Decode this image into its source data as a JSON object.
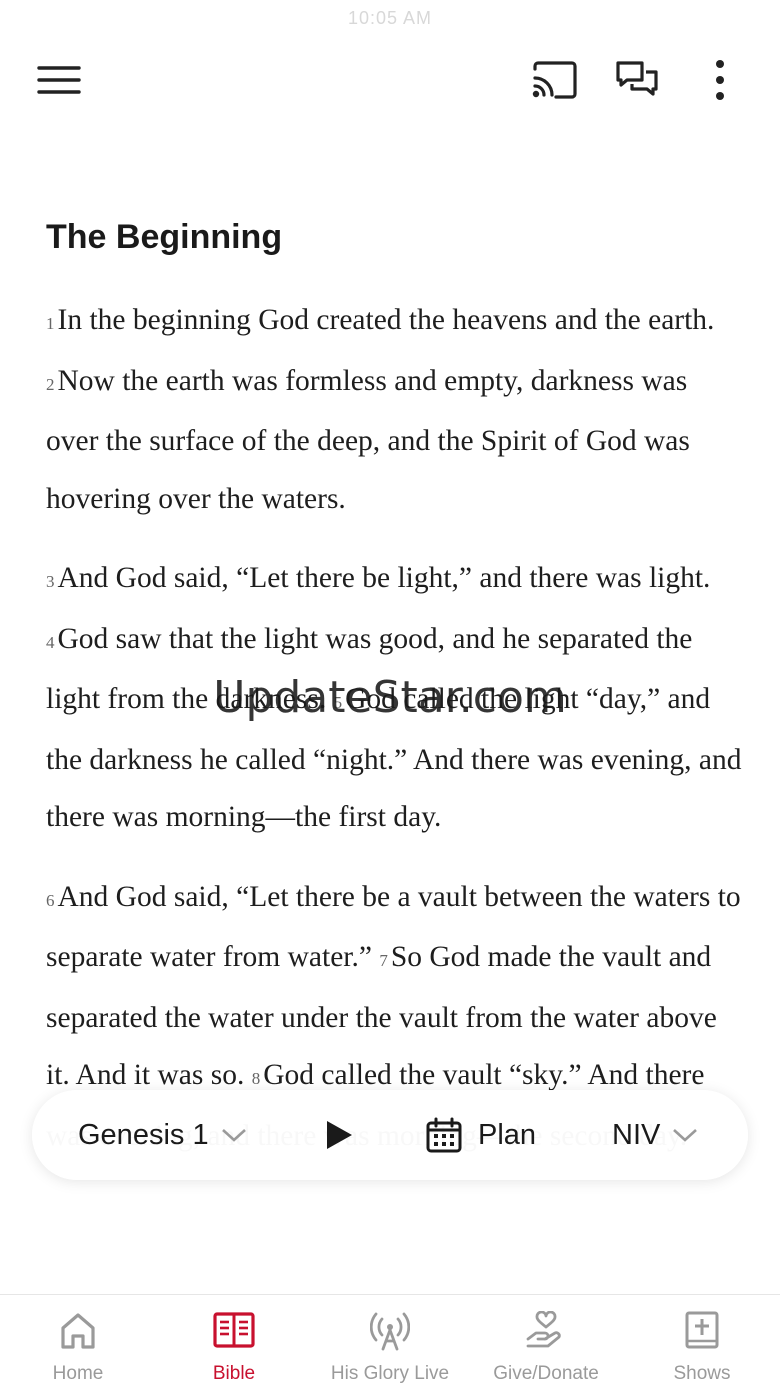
{
  "status": {
    "time": "10:05 AM"
  },
  "topbar": {
    "menu_icon": "hamburger-menu-icon",
    "cast_icon": "cast-icon",
    "chat_icon": "chat-bubbles-icon",
    "more_icon": "more-vertical-icon"
  },
  "passage": {
    "heading": "The Beginning",
    "paragraphs": [
      [
        {
          "n": "1",
          "t": "In the beginning God created the heavens and the earth."
        },
        {
          "n": "2",
          "t": "Now the earth was formless and empty, darkness was over the surface of the deep, and the Spirit of God was hovering over the waters."
        }
      ],
      [
        {
          "n": "3",
          "t": "And God said, “Let there be light,” and there was light."
        },
        {
          "n": "4",
          "t": "God saw that the light was good, and he separated the light from the darkness."
        },
        {
          "n": "5",
          "t": "God called the light “day,” and the darkness he called “night.” And there was evening, and there was morning—the first day."
        }
      ],
      [
        {
          "n": "6",
          "t": "And God said, “Let there be a vault between the waters to separate water from water.”"
        },
        {
          "n": "7",
          "t": "So God made the vault and separated the water under the vault from the water above it. And it was so."
        },
        {
          "n": "8",
          "t": "God called the vault “sky.” And there was evening, and there was morning—the second day."
        }
      ]
    ]
  },
  "watermark": "UpdateStar.com",
  "controls": {
    "book_chapter": "Genesis 1",
    "plan_label": "Plan",
    "version": "NIV",
    "play_icon": "play-icon",
    "calendar_icon": "calendar-icon",
    "chevron_icon": "chevron-down-icon"
  },
  "tabs": [
    {
      "label": "Home",
      "icon": "home-icon",
      "active": false
    },
    {
      "label": "Bible",
      "icon": "bible-book-icon",
      "active": true
    },
    {
      "label": "His Glory Live",
      "icon": "broadcast-antenna-icon",
      "active": false
    },
    {
      "label": "Give/Donate",
      "icon": "hand-heart-icon",
      "active": false
    },
    {
      "label": "Shows",
      "icon": "shows-book-plus-icon",
      "active": false
    }
  ],
  "colors": {
    "accent": "#c8102e",
    "tab_inactive": "#9a9a9a",
    "text": "#1e1e1e"
  }
}
